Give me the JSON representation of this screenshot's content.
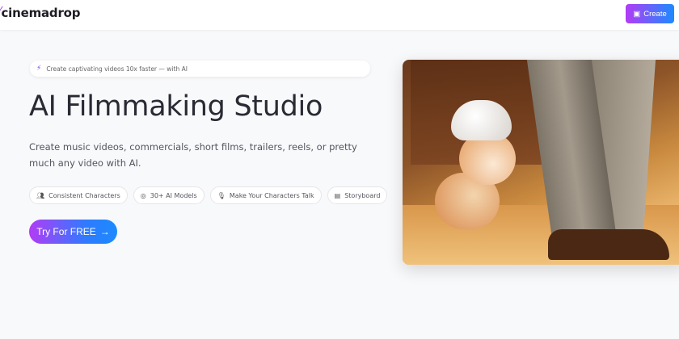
{
  "nav": {
    "logo": "cinemadrop",
    "create_label": "Create"
  },
  "hero": {
    "tagline": "Create captivating videos 10x faster — with AI",
    "title": "AI Filmmaking Studio",
    "description": "Create music videos, commercials, short films, trailers, reels, or pretty much any video with AI.",
    "features": [
      {
        "icon": "users-icon",
        "label": "Consistent Characters"
      },
      {
        "icon": "models-icon",
        "label": "30+ AI Models"
      },
      {
        "icon": "microphone-icon",
        "label": "Make Your Characters Talk"
      },
      {
        "icon": "film-icon",
        "label": "Storyboard"
      }
    ],
    "cta_label": "Try For FREE",
    "cta_arrow": "→"
  },
  "colors": {
    "gradient_start": "#b23cf5",
    "gradient_end": "#1b8bff"
  }
}
